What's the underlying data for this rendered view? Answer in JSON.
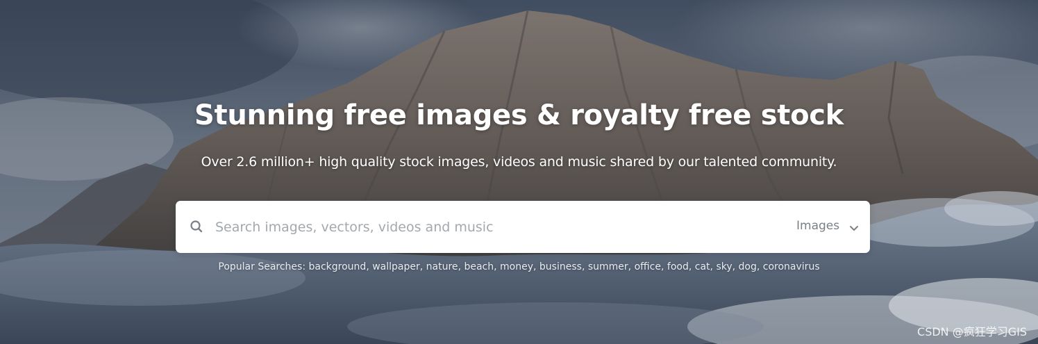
{
  "hero": {
    "title": "Stunning free images & royalty free stock",
    "subtitle": "Over 2.6 million+ high quality stock images, videos and music shared by our talented community."
  },
  "search": {
    "icon": "search-icon",
    "placeholder": "Search images, vectors, videos and music",
    "value": "",
    "type_selected": "Images",
    "type_icon": "chevron-down-icon"
  },
  "popular": {
    "label": "Popular Searches:",
    "terms": [
      "background",
      "wallpaper",
      "nature",
      "beach",
      "money",
      "business",
      "summer",
      "office",
      "food",
      "cat",
      "sky",
      "dog",
      "coronavirus"
    ]
  },
  "watermark": "CSDN @疯狂学习GIS",
  "colors": {
    "sky": "#5a6676",
    "mountain": "#8c7e72",
    "text": "#ffffff",
    "placeholder": "#a3a8ad"
  }
}
